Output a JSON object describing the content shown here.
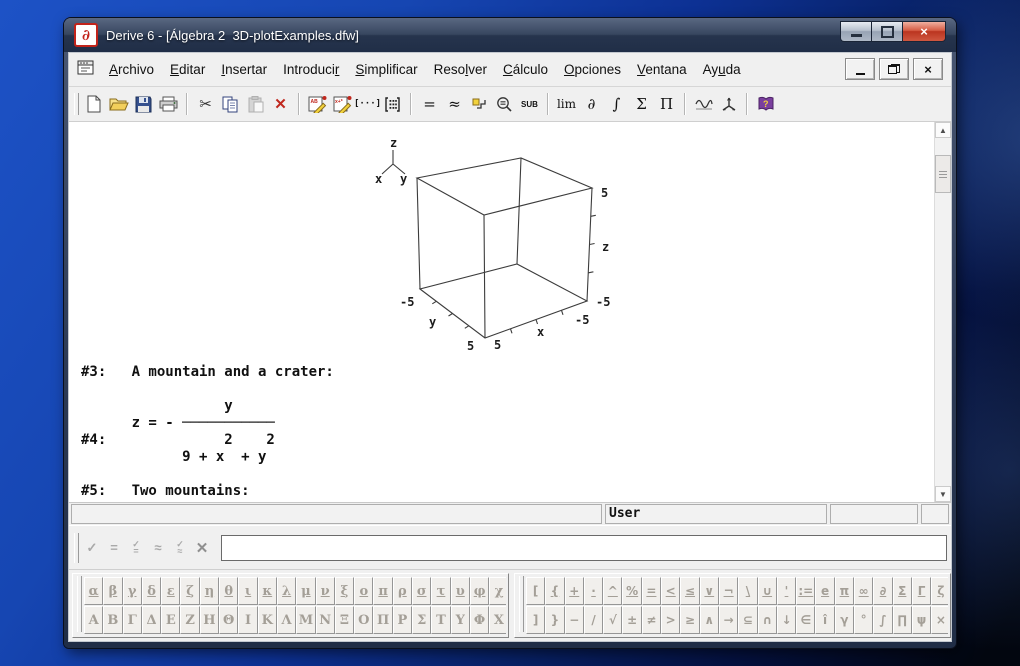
{
  "window": {
    "title": "Derive 6 - [Álgebra 2  3D-plotExamples.dfw]",
    "app_icon_glyph": "∂"
  },
  "menu": {
    "items": [
      {
        "pre": "",
        "mn": "A",
        "post": "rchivo"
      },
      {
        "pre": "",
        "mn": "E",
        "post": "ditar"
      },
      {
        "pre": "",
        "mn": "I",
        "post": "nsertar"
      },
      {
        "pre": "Introduci",
        "mn": "r",
        "post": ""
      },
      {
        "pre": "",
        "mn": "S",
        "post": "implificar"
      },
      {
        "pre": "Reso",
        "mn": "l",
        "post": "ver"
      },
      {
        "pre": "",
        "mn": "C",
        "post": "álculo"
      },
      {
        "pre": "",
        "mn": "O",
        "post": "pciones"
      },
      {
        "pre": "",
        "mn": "V",
        "post": "entana"
      },
      {
        "pre": "Ay",
        "mn": "u",
        "post": "da"
      }
    ]
  },
  "toolbar": {
    "glyphs": {
      "simplify": "=",
      "approximate": "≈",
      "sub_label": "SUB",
      "lens": "=",
      "lim": "lim",
      "derivative": "∂",
      "integral": "∫",
      "sum": "Σ",
      "product": "Π",
      "vector": "[···]"
    }
  },
  "doc": {
    "lines": [
      "#3:   A mountain and a crater:",
      "",
      "                 y",
      "      z = - ───────────",
      "#4:              2    2",
      "            9 + x  + y",
      "",
      "#5:   Two mountains:"
    ]
  },
  "plot": {
    "triad": {
      "x": "x",
      "y": "y",
      "z": "z"
    },
    "labels": {
      "z_max": "5",
      "z_axis": "z",
      "z_min": "-5",
      "x_axis": "x",
      "x_right": "-5",
      "x_front": "5",
      "y_axis": "y",
      "y_left": "-5",
      "y_front": "5"
    }
  },
  "chart_data": {
    "type": "3d-wireframe-box",
    "title": "",
    "axes": {
      "x": {
        "label": "x",
        "range": [
          -5,
          5
        ]
      },
      "y": {
        "label": "y",
        "range": [
          -5,
          5
        ]
      },
      "z": {
        "label": "z",
        "range": [
          -5,
          5
        ]
      }
    },
    "content": "Empty 3D plot bounding box (wireframe cube) with axis triad indicator at upper left; tick marks along x, y and z edges"
  },
  "statusbar": {
    "user": "User"
  },
  "entry": {
    "check": "✓",
    "equals": "=",
    "approx": "≈",
    "clear": "✕",
    "value": ""
  },
  "symbols": {
    "greek_lower": [
      "α",
      "β",
      "γ",
      "δ",
      "ε",
      "ζ",
      "η",
      "θ",
      "ι",
      "κ",
      "λ",
      "μ",
      "ν",
      "ξ",
      "ο",
      "π",
      "ρ",
      "σ",
      "τ",
      "υ",
      "φ",
      "χ"
    ],
    "greek_upper": [
      "Α",
      "Β",
      "Γ",
      "Δ",
      "Ε",
      "Ζ",
      "Η",
      "Θ",
      "Ι",
      "Κ",
      "Λ",
      "Μ",
      "Ν",
      "Ξ",
      "Ο",
      "Π",
      "Ρ",
      "Σ",
      "Τ",
      "Υ",
      "Φ",
      "Χ"
    ],
    "math_row1": [
      "[",
      "{",
      "+",
      "·",
      "^",
      "%",
      "=",
      "<",
      "≤",
      "∨",
      "¬",
      "\\",
      "∪",
      "'",
      ":=",
      "e",
      "π",
      "∞",
      "∂",
      "Σ",
      "Γ",
      "ζ"
    ],
    "math_row2": [
      "]",
      "}",
      "−",
      "/",
      "√",
      "±",
      "≠",
      ">",
      "≥",
      "∧",
      "→",
      "⊆",
      "∩",
      "↓",
      "∈",
      "î",
      "γ",
      "°",
      "∫",
      "∏",
      "ψ",
      "×"
    ]
  }
}
